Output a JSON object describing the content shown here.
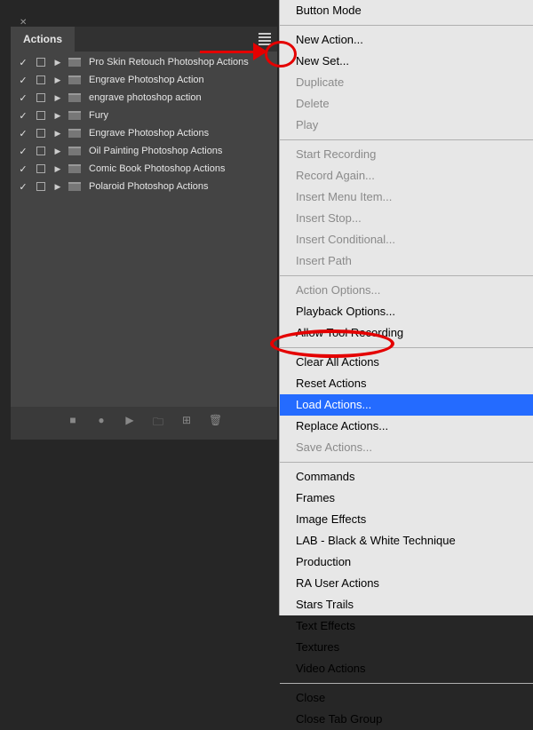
{
  "panel": {
    "tab": "Actions"
  },
  "rows": [
    {
      "name": "Pro Skin Retouch Photoshop Actions"
    },
    {
      "name": "Engrave Photoshop Action"
    },
    {
      "name": "engrave photoshop action"
    },
    {
      "name": "Fury"
    },
    {
      "name": "Engrave Photoshop Actions"
    },
    {
      "name": "Oil Painting Photoshop Actions"
    },
    {
      "name": "Comic Book Photoshop Actions"
    },
    {
      "name": "Polaroid Photoshop Actions"
    }
  ],
  "footer": {
    "stop": "■",
    "record": "●",
    "play": "▶",
    "newset": "🗀",
    "newaction": "⊞",
    "trash": "🗑"
  },
  "menu": [
    {
      "label": "Button Mode",
      "type": "item"
    },
    {
      "type": "sep"
    },
    {
      "label": "New Action...",
      "type": "item"
    },
    {
      "label": "New Set...",
      "type": "item"
    },
    {
      "label": "Duplicate",
      "type": "disabled"
    },
    {
      "label": "Delete",
      "type": "disabled"
    },
    {
      "label": "Play",
      "type": "disabled"
    },
    {
      "type": "sep"
    },
    {
      "label": "Start Recording",
      "type": "disabled"
    },
    {
      "label": "Record Again...",
      "type": "disabled"
    },
    {
      "label": "Insert Menu Item...",
      "type": "disabled"
    },
    {
      "label": "Insert Stop...",
      "type": "disabled"
    },
    {
      "label": "Insert Conditional...",
      "type": "disabled"
    },
    {
      "label": "Insert Path",
      "type": "disabled"
    },
    {
      "type": "sep"
    },
    {
      "label": "Action Options...",
      "type": "disabled"
    },
    {
      "label": "Playback Options...",
      "type": "item"
    },
    {
      "label": "Allow Tool Recording",
      "type": "item"
    },
    {
      "type": "sep"
    },
    {
      "label": "Clear All Actions",
      "type": "item"
    },
    {
      "label": "Reset Actions",
      "type": "item"
    },
    {
      "label": "Load Actions...",
      "type": "selected"
    },
    {
      "label": "Replace Actions...",
      "type": "item"
    },
    {
      "label": "Save Actions...",
      "type": "disabled"
    },
    {
      "type": "sep"
    },
    {
      "label": "Commands",
      "type": "item"
    },
    {
      "label": "Frames",
      "type": "item"
    },
    {
      "label": "Image Effects",
      "type": "item"
    },
    {
      "label": "LAB - Black & White Technique",
      "type": "item"
    },
    {
      "label": "Production",
      "type": "item"
    },
    {
      "label": "RA User Actions",
      "type": "item"
    },
    {
      "label": "Stars Trails",
      "type": "item"
    },
    {
      "label": "Text Effects",
      "type": "item"
    },
    {
      "label": "Textures",
      "type": "item"
    },
    {
      "label": "Video Actions",
      "type": "item"
    },
    {
      "type": "sep"
    },
    {
      "label": "Close",
      "type": "item"
    },
    {
      "label": "Close Tab Group",
      "type": "item"
    }
  ]
}
